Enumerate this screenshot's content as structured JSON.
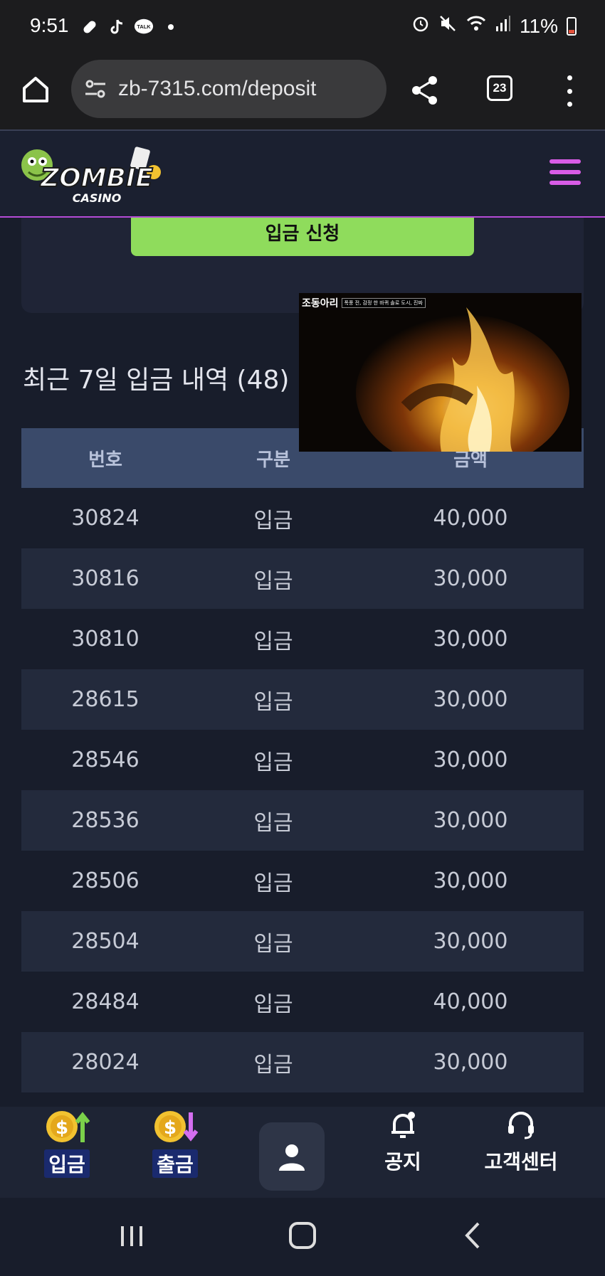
{
  "status_bar": {
    "time": "9:51",
    "left_icons": [
      "pill-icon",
      "tiktok-icon",
      "talk-icon",
      "dot-icon"
    ],
    "talk_label": "TALK",
    "battery": "11%",
    "right_icons": [
      "alarm-icon",
      "mute-icon",
      "wifi-icon",
      "signal-icon",
      "battery-icon"
    ]
  },
  "browser": {
    "url": "zb-7315.com/deposit",
    "tab_count": "23"
  },
  "site": {
    "logo_main": "ZOMBIE",
    "logo_sub": "CASINO",
    "accent_color": "#d85ce6",
    "button_color": "#8fdc5c"
  },
  "deposit": {
    "apply_button": "입금 신청"
  },
  "history": {
    "title": "최근 7일 입금 내역 (48)",
    "columns": [
      "번호",
      "구분",
      "금액"
    ],
    "rows": [
      {
        "no": "30824",
        "type": "입금",
        "amount": "40,000"
      },
      {
        "no": "30816",
        "type": "입금",
        "amount": "30,000"
      },
      {
        "no": "30810",
        "type": "입금",
        "amount": "30,000"
      },
      {
        "no": "28615",
        "type": "입금",
        "amount": "30,000"
      },
      {
        "no": "28546",
        "type": "입금",
        "amount": "30,000"
      },
      {
        "no": "28536",
        "type": "입금",
        "amount": "30,000"
      },
      {
        "no": "28506",
        "type": "입금",
        "amount": "30,000"
      },
      {
        "no": "28504",
        "type": "입금",
        "amount": "30,000"
      },
      {
        "no": "28484",
        "type": "입금",
        "amount": "40,000"
      },
      {
        "no": "28024",
        "type": "입금",
        "amount": "30,000"
      }
    ]
  },
  "video_overlay": {
    "logo_text": "조동아리",
    "caption": "폭풍 전, 감정 한 바퀴 솔로 도시, 진짜"
  },
  "bottom_nav": {
    "deposit": "입금",
    "withdraw": "출금",
    "notice": "공지",
    "support": "고객센터"
  }
}
